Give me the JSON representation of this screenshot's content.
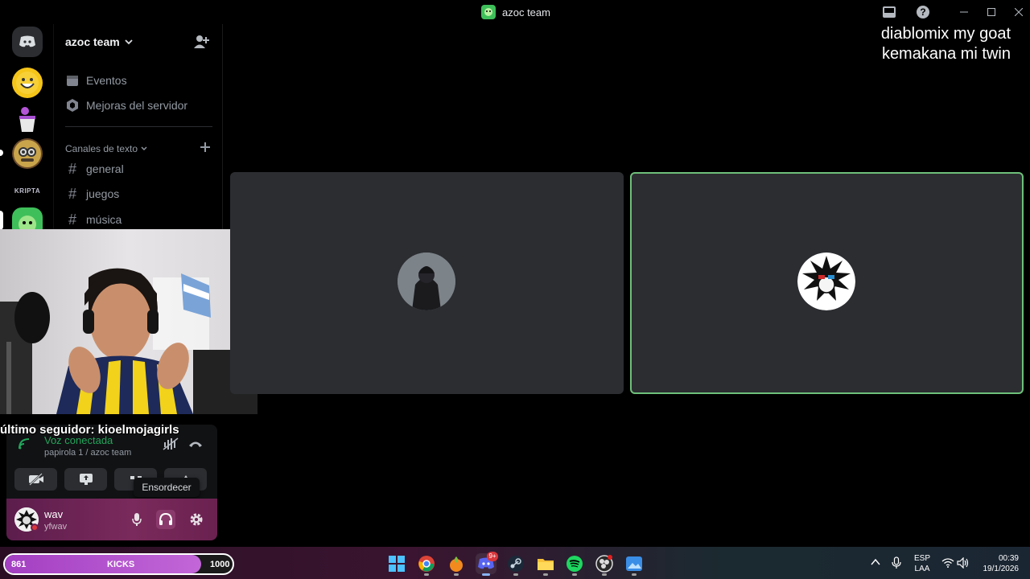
{
  "window": {
    "title": "azoc team"
  },
  "overlay": {
    "line1": "diablomix my goat",
    "line2": "kemakana mi twin"
  },
  "server": {
    "name": "azoc team",
    "menu": [
      {
        "label": "Eventos",
        "icon": "calendar-icon"
      },
      {
        "label": "Mejoras del servidor",
        "icon": "boost-icon"
      }
    ],
    "category": "Canales de texto",
    "channels": [
      {
        "name": "general"
      },
      {
        "name": "juegos"
      },
      {
        "name": "música"
      }
    ]
  },
  "stream": {
    "follower_text": "último seguidor: kioelmojagirls"
  },
  "voice": {
    "status": "Voz conectada",
    "location": "papirola 1 / azoc team"
  },
  "tooltip": {
    "text": "Ensordecer"
  },
  "user": {
    "name": "wav",
    "handle": "yfwav"
  },
  "kicks": {
    "current": "861",
    "label": "KICKS",
    "goal": "1000",
    "progress": 0.861
  },
  "taskbar": {
    "apps": [
      "windows-start",
      "chrome",
      "fl-studio",
      "discord",
      "steam",
      "file-explorer",
      "spotify",
      "obs",
      "photos"
    ],
    "discord_badge": "9+",
    "lang1": "ESP",
    "lang2": "LAA",
    "time": "00:39",
    "date": "19/1/2026"
  },
  "colors": {
    "accent_green": "#23a55a",
    "speaking_border": "#6ec07a",
    "kick_purple": "#a33fc2"
  }
}
